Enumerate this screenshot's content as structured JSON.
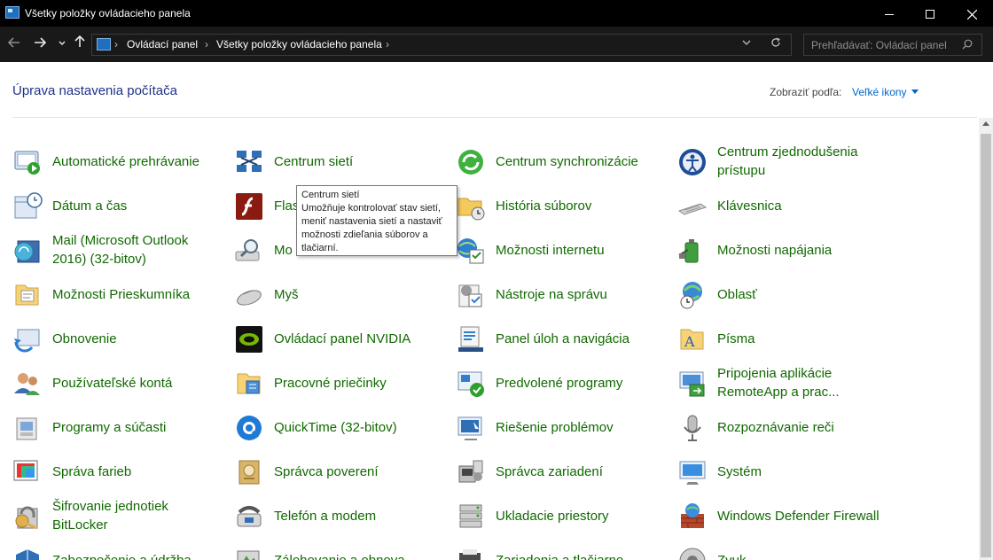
{
  "window": {
    "title": "Všetky položky ovládacieho panela"
  },
  "addressbar": {
    "crumbs": [
      "Ovládací panel",
      "Všetky položky ovládacieho panela"
    ]
  },
  "search": {
    "placeholder": "Prehľadávať: Ovládací panel"
  },
  "header": {
    "title": "Úprava nastavenia počítača",
    "view_label": "Zobraziť podľa:",
    "view_value": "Veľké ikony"
  },
  "items": [
    {
      "label": "Automatické prehrávanie",
      "icon": "autoplay-icon"
    },
    {
      "label": "Centrum sietí",
      "icon": "network-center-icon"
    },
    {
      "label": "Centrum synchronizácie",
      "icon": "sync-center-icon"
    },
    {
      "label": "Centrum zjednodušenia prístupu",
      "icon": "ease-of-access-icon"
    },
    {
      "label": "Dátum a čas",
      "icon": "calendar-clock-icon"
    },
    {
      "label": "Flas",
      "icon": "flash-icon"
    },
    {
      "label": "História súborov",
      "icon": "file-history-icon"
    },
    {
      "label": "Klávesnica",
      "icon": "keyboard-icon"
    },
    {
      "label": "Mail (Microsoft Outlook 2016) (32-bitov)",
      "icon": "mail-icon"
    },
    {
      "label": "Mo",
      "icon": "magnifier-icon"
    },
    {
      "label": "Možnosti internetu",
      "icon": "internet-options-icon"
    },
    {
      "label": "Možnosti napájania",
      "icon": "power-options-icon"
    },
    {
      "label": "Možnosti Prieskumníka",
      "icon": "folder-options-icon"
    },
    {
      "label": "Myš",
      "icon": "mouse-icon"
    },
    {
      "label": "Nástroje na správu",
      "icon": "admin-tools-icon"
    },
    {
      "label": "Oblasť",
      "icon": "region-icon"
    },
    {
      "label": "Obnovenie",
      "icon": "recovery-icon"
    },
    {
      "label": "Ovládací panel NVIDIA",
      "icon": "nvidia-icon"
    },
    {
      "label": "Panel úloh a navigácia",
      "icon": "taskbar-icon"
    },
    {
      "label": "Písma",
      "icon": "fonts-icon"
    },
    {
      "label": "Používateľské kontá",
      "icon": "user-accounts-icon"
    },
    {
      "label": "Pracovné priečinky",
      "icon": "work-folders-icon"
    },
    {
      "label": "Predvolené programy",
      "icon": "default-programs-icon"
    },
    {
      "label": "Pripojenia aplikácie RemoteApp a prac...",
      "icon": "remoteapp-icon"
    },
    {
      "label": "Programy a súčasti",
      "icon": "programs-features-icon"
    },
    {
      "label": "QuickTime (32-bitov)",
      "icon": "quicktime-icon"
    },
    {
      "label": "Riešenie problémov",
      "icon": "troubleshooting-icon"
    },
    {
      "label": "Rozpoznávanie reči",
      "icon": "microphone-icon"
    },
    {
      "label": "Správa farieb",
      "icon": "color-management-icon"
    },
    {
      "label": "Správca poverení",
      "icon": "credential-manager-icon"
    },
    {
      "label": "Správca zariadení",
      "icon": "device-manager-icon"
    },
    {
      "label": "Systém",
      "icon": "system-icon"
    },
    {
      "label": "Šifrovanie jednotiek BitLocker",
      "icon": "bitlocker-icon"
    },
    {
      "label": "Telefón a modem",
      "icon": "phone-modem-icon"
    },
    {
      "label": "Ukladacie priestory",
      "icon": "storage-spaces-icon"
    },
    {
      "label": "Windows Defender Firewall",
      "icon": "firewall-icon"
    },
    {
      "label": "Zabezpečenie a údržba",
      "icon": "security-maintenance-icon"
    },
    {
      "label": "Zálohovanie a obnova",
      "icon": "backup-restore-icon"
    },
    {
      "label": "Zariadenia a tlačiarne",
      "icon": "devices-printers-icon"
    },
    {
      "label": "Zvuk",
      "icon": "sound-icon"
    }
  ],
  "tooltip": {
    "title": "Centrum sietí",
    "lines": [
      "Umožňuje kontrolovať stav sietí,",
      "meniť nastavenia sietí a nastaviť",
      "možnosti zdieľania súborov a",
      "tlačiarní."
    ]
  }
}
